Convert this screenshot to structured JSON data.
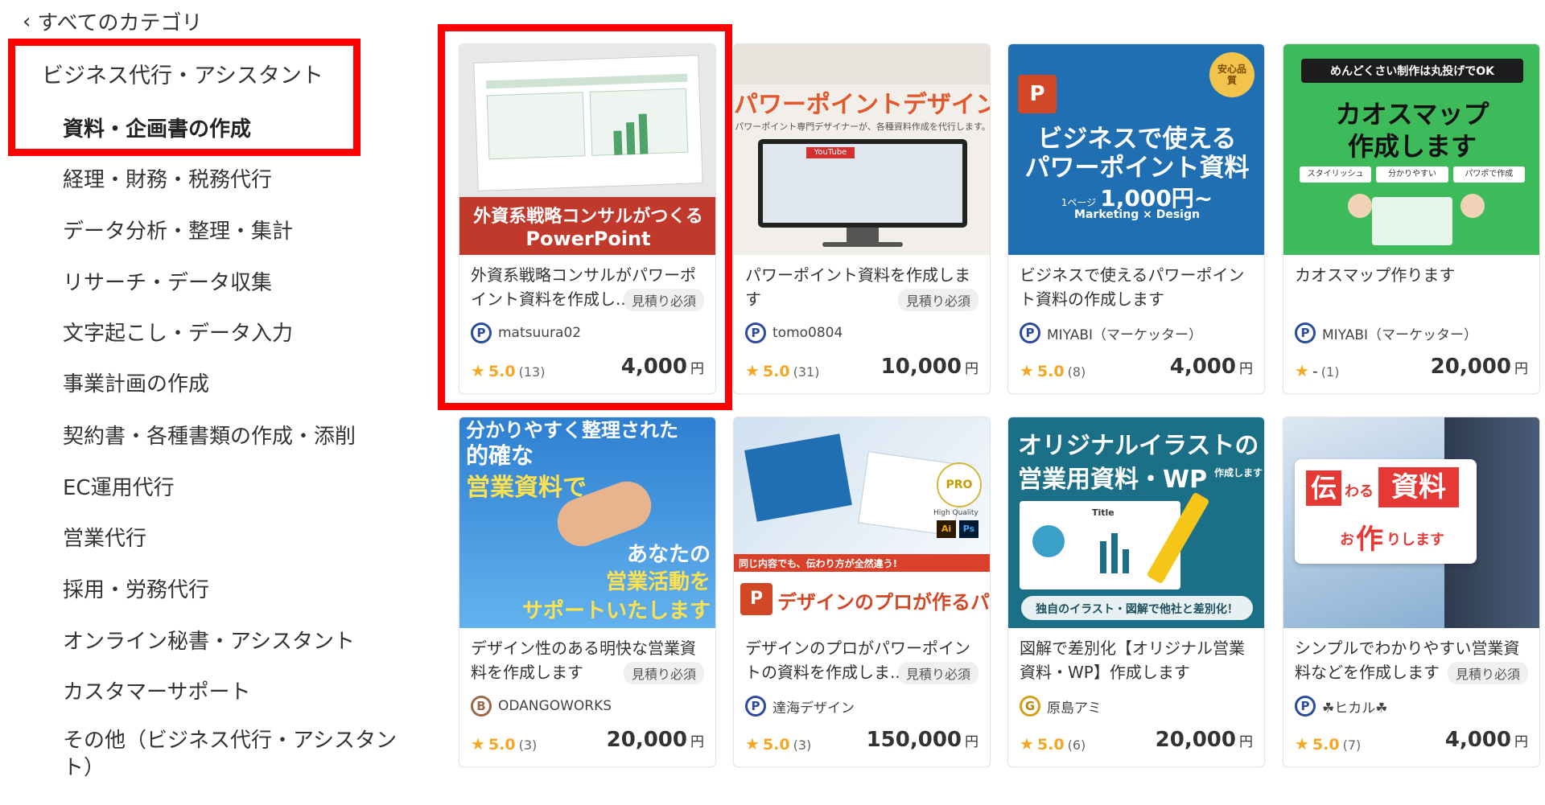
{
  "sidebar": {
    "back_label": "すべてのカテゴリ",
    "parent_label": "ビジネス代行・アシスタント",
    "items": [
      {
        "label": "資料・企画書の作成",
        "active": true
      },
      {
        "label": "経理・財務・税務代行"
      },
      {
        "label": "データ分析・整理・集計"
      },
      {
        "label": "リサーチ・データ収集"
      },
      {
        "label": "文字起こし・データ入力"
      },
      {
        "label": "事業計画の作成"
      },
      {
        "label": "契約書・各種書類の作成・添削"
      },
      {
        "label": "EC運用代行"
      },
      {
        "label": "営業代行"
      },
      {
        "label": "採用・労務代行"
      },
      {
        "label": "オンライン秘書・アシスタント"
      },
      {
        "label": "カスタマーサポート"
      },
      {
        "label": "その他（ビジネス代行・アシスタント）"
      }
    ]
  },
  "cards": [
    {
      "thumb": {
        "banner1": "外資系戦略コンサルがつくる",
        "banner2": "PowerPoint"
      },
      "title": "外資系戦略コンサルがパワーポイント資料を作成し...",
      "estimate": "見積り必須",
      "seller": "matsuura02",
      "badge": "P",
      "rating": "5.0",
      "reviews": "(13)",
      "price": "4,000",
      "yen": "円"
    },
    {
      "thumb": {
        "headline": "パワーポイントデザイン",
        "sub": "パワーポイント専門デザイナーが、各種資料作成を代行します。",
        "tag": "YouTube"
      },
      "title": "パワーポイント資料を作成します",
      "estimate": "見積り必須",
      "seller": "tomo0804",
      "badge": "P",
      "rating": "5.0",
      "reviews": "(31)",
      "price": "10,000",
      "yen": "円"
    },
    {
      "thumb": {
        "line1": "ビジネスで使える",
        "line2": "パワーポイント資料",
        "prefix": "1ページ",
        "price": "1,000円~",
        "tagline": "Marketing × Design",
        "medal": "安心品質"
      },
      "title": "ビジネスで使えるパワーポイント資料の作成します",
      "estimate": "",
      "seller": "MIYABI（マーケッター）",
      "badge": "P",
      "rating": "5.0",
      "reviews": "(8)",
      "price": "4,000",
      "yen": "円"
    },
    {
      "thumb": {
        "top": "めんどくさい制作は丸投げでOK",
        "line1": "カオスマップ",
        "line2": "作成します",
        "chip1": "スタイリッシュ",
        "chip2": "分かりやすい",
        "chip3": "パワポで作成"
      },
      "title": "カオスマップ作ります",
      "estimate": "",
      "seller": "MIYABI（マーケッター）",
      "badge": "P",
      "rating": "-",
      "reviews": "(1)",
      "price": "20,000",
      "yen": "円"
    },
    {
      "thumb": {
        "line0": "分かりやすく整理された",
        "line1": "的確な",
        "line2": "営業資料で",
        "line3": "あなたの",
        "line4": "営業活動を",
        "line5": "サポートいたします"
      },
      "title": "デザイン性のある明快な営業資料を作成します",
      "estimate": "見積り必須",
      "seller": "ODANGOWORKS",
      "badge": "B",
      "rating": "5.0",
      "reviews": "(3)",
      "price": "20,000",
      "yen": "円"
    },
    {
      "thumb": {
        "caption": "同じ内容でも、伝わり方が全然違う!",
        "footer": "デザインのプロが作るパワポ資料",
        "pro": "PRO",
        "hq": "High Quality"
      },
      "title": "デザインのプロがパワーポイントの資料を作成しま...",
      "estimate": "見積り必須",
      "seller": "達海デザイン",
      "badge": "P",
      "rating": "5.0",
      "reviews": "(3)",
      "price": "150,000",
      "yen": "円"
    },
    {
      "thumb": {
        "line1": "オリジナルイラストの",
        "line2": "営業用資料・WP",
        "small": "作成します",
        "footer": "独自のイラスト・図解で他社と差別化！",
        "doc": "Title"
      },
      "title": "図解で差別化【オリジナル営業資料・WP】作成します",
      "estimate": "",
      "seller": "原島アミ",
      "badge": "G",
      "rating": "5.0",
      "reviews": "(6)",
      "price": "20,000",
      "yen": "円"
    },
    {
      "thumb": {
        "w1": "伝",
        "w2": "わる",
        "w3": "資料",
        "w4": "お",
        "w5": "作",
        "w6": "りします"
      },
      "title": "シンプルでわかりやすい営業資料などを作成します",
      "estimate": "見積り必須",
      "seller": "☘ヒカル☘",
      "badge": "P",
      "rating": "5.0",
      "reviews": "(7)",
      "price": "4,000",
      "yen": "円"
    }
  ]
}
